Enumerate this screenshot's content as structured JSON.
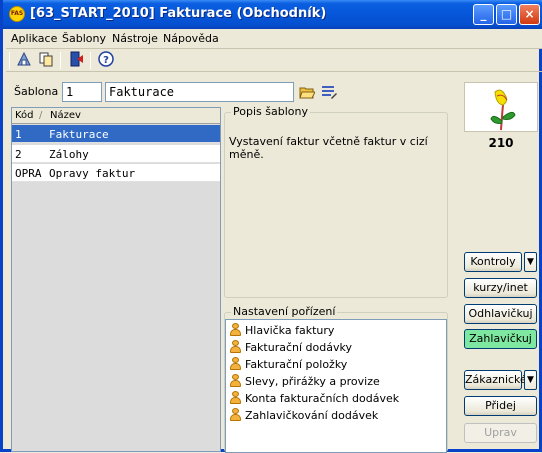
{
  "window": {
    "app_icon_text": "FAS",
    "title": "[63_START_2010] Fakturace (Obchodník)",
    "minimize": "_",
    "maximize": "□",
    "close": "×"
  },
  "menu": [
    "Aplikace",
    "Šablony",
    "Nástroje",
    "Nápověda"
  ],
  "toolbar": {
    "icons": [
      "print-preview-icon",
      "copy-icon",
      "exit-icon",
      "help-icon"
    ]
  },
  "sablona": {
    "label": "Šablona :",
    "code": "1",
    "name": "Fakturace",
    "open_glyph": "📂",
    "edit_glyph": "☰"
  },
  "list": {
    "headers": {
      "code": "Kód",
      "name": "Název"
    },
    "rows": [
      {
        "code": "1",
        "name": "Fakturace",
        "selected": true
      },
      {
        "code": "2",
        "name": "Zálohy",
        "selected": false
      },
      {
        "code": "OPRA",
        "name": "Opravy faktur",
        "selected": false
      }
    ]
  },
  "description": {
    "title": "Popis šablony",
    "text": "Vystavení faktur včetně faktur v cizí měně."
  },
  "settings": {
    "title": "Nastavení pořízení",
    "items": [
      "Hlavička faktury",
      "Fakturační dodávky",
      "Fakturační položky",
      "Slevy, přirážky a provize",
      "Konta fakturačních dodávek",
      "Zahlavičkování dodávek"
    ]
  },
  "logo": {
    "number": "210",
    "colors": {
      "petal": "#f5e000",
      "leaf": "#2e9a2e",
      "stem": "#c03a3a"
    }
  },
  "buttons": {
    "kontroly": "Kontroly",
    "dropdown_arrow": "▼",
    "kurzy": "kurzy/inet",
    "odhlavickuj": "Odhlavičkuj",
    "zahlavickuj": "Zahlavičkuj",
    "zakaznicke": "Zákaznické",
    "pridej": "Přidej",
    "uprav": "Uprav"
  }
}
